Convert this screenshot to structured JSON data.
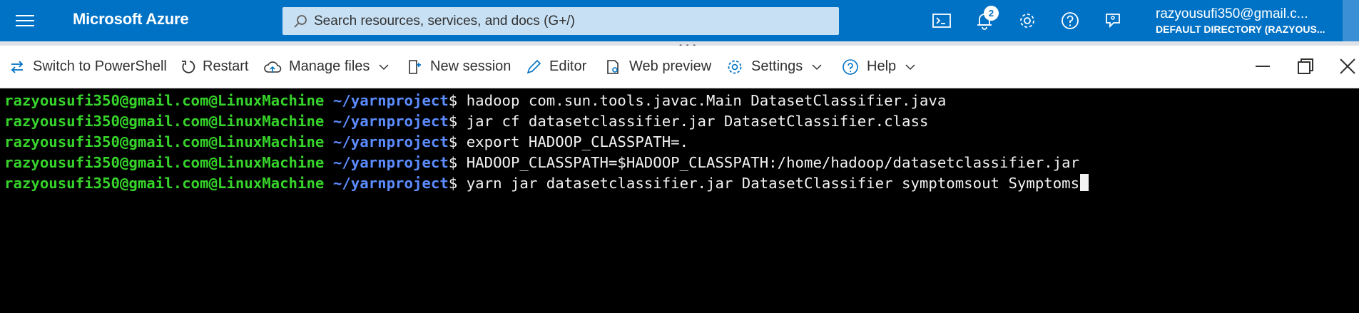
{
  "topbar": {
    "brand": "Microsoft Azure",
    "search_placeholder": "Search resources, services, and docs (G+/)",
    "notifications_count": "2",
    "account_email": "razyousufi350@gmail.c...",
    "account_directory": "DEFAULT DIRECTORY (RAZYOUS..."
  },
  "toolbar": {
    "switch_label": "Switch to PowerShell",
    "restart_label": "Restart",
    "manage_files_label": "Manage files",
    "new_session_label": "New session",
    "editor_label": "Editor",
    "web_preview_label": "Web preview",
    "settings_label": "Settings",
    "help_label": "Help"
  },
  "terminal": {
    "lines": [
      {
        "user": "razyousufi350@gmail.com@LinuxMachine",
        "path": "~/yarnproject",
        "cmd": "hadoop com.sun.tools.javac.Main DatasetClassifier.java"
      },
      {
        "user": "razyousufi350@gmail.com@LinuxMachine",
        "path": "~/yarnproject",
        "cmd": "jar cf datasetclassifier.jar DatasetClassifier.class"
      },
      {
        "user": "razyousufi350@gmail.com@LinuxMachine",
        "path": "~/yarnproject",
        "cmd": "export HADOOP_CLASSPATH=."
      },
      {
        "user": "razyousufi350@gmail.com@LinuxMachine",
        "path": "~/yarnproject",
        "cmd": "HADOOP_CLASSPATH=$HADOOP_CLASSPATH:/home/hadoop/datasetclassifier.jar"
      },
      {
        "user": "razyousufi350@gmail.com@LinuxMachine",
        "path": "~/yarnproject",
        "cmd": "yarn jar datasetclassifier.jar DatasetClassifier symptomsout Symptoms"
      }
    ]
  },
  "colors": {
    "azure_blue": "#0072c6",
    "prompt_user": "#36d32a",
    "prompt_path": "#5c8cff",
    "terminal_bg": "#000000"
  }
}
